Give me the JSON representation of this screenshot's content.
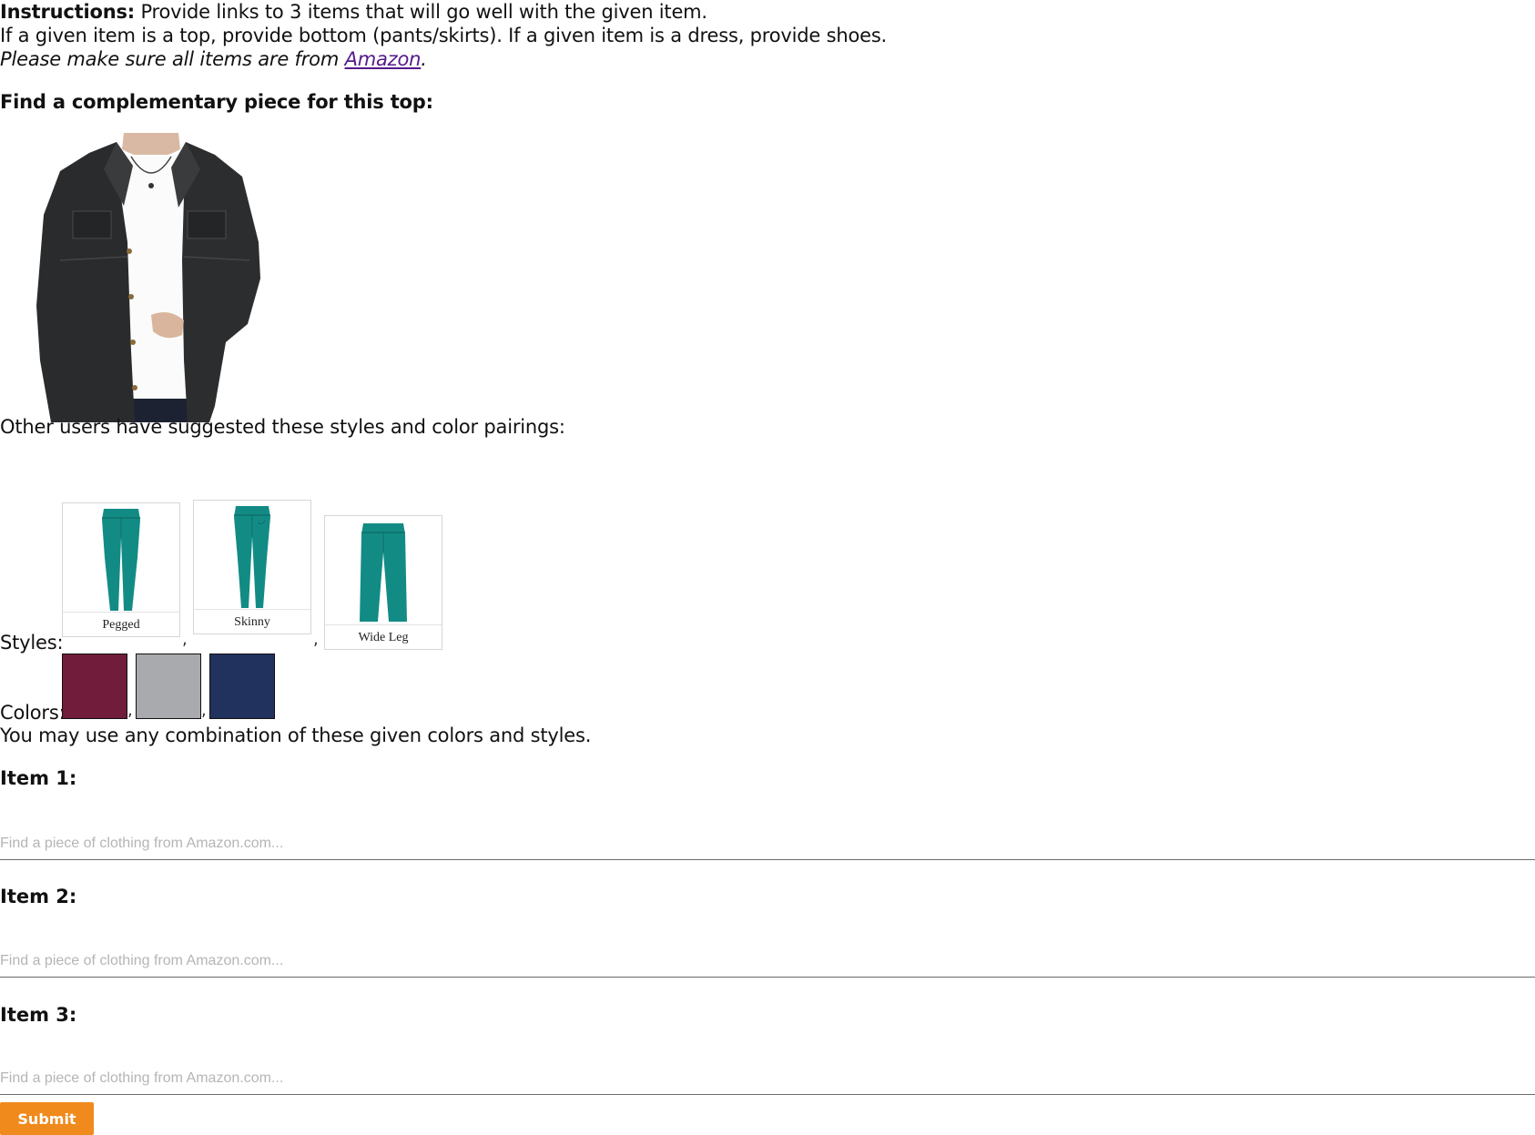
{
  "instructions": {
    "label": "Instructions:",
    "text": " Provide links to 3 items that will go well with the given item.",
    "line2": "If a given item is a top, provide bottom (pants/skirts). If a given item is a dress, provide shoes.",
    "line3_prefix": "Please make sure all items are from ",
    "amazon_link": "Amazon",
    "line3_suffix": "."
  },
  "given_item": {
    "heading": "Find a complementary piece for this top:",
    "icon": "denim-jacket-photo"
  },
  "suggestions": {
    "intro": "Other users have suggested these styles and color pairings:",
    "styles_label": "Styles:",
    "styles": [
      {
        "name": "Pegged"
      },
      {
        "name": "Skinny"
      },
      {
        "name": "Wide Leg"
      }
    ],
    "colors_label": "Colors:",
    "colors": [
      "#711c3a",
      "#a8aaad",
      "#22325e"
    ],
    "separator": ",",
    "note": "You may use any combination of these given colors and styles."
  },
  "items": [
    {
      "label": "Item 1:",
      "placeholder": "Find a piece of clothing from Amazon.com..."
    },
    {
      "label": "Item 2:",
      "placeholder": "Find a piece of clothing from Amazon.com..."
    },
    {
      "label": "Item 3:",
      "placeholder": "Find a piece of clothing from Amazon.com..."
    }
  ],
  "submit_label": "Submit"
}
